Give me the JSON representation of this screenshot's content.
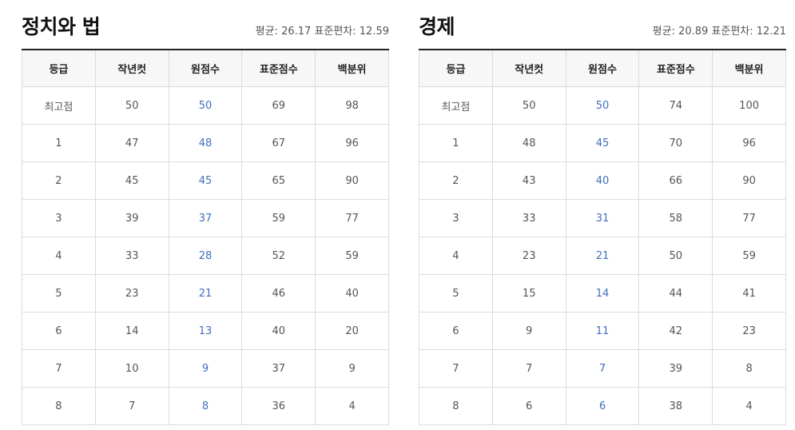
{
  "panels": [
    {
      "title": "정치와 법",
      "stats": "평균: 26.17 표준편차: 12.59",
      "headers": [
        "등급",
        "작년컷",
        "원점수",
        "표준점수",
        "백분위"
      ],
      "rows": [
        [
          "최고점",
          "50",
          "50",
          "69",
          "98"
        ],
        [
          "1",
          "47",
          "48",
          "67",
          "96"
        ],
        [
          "2",
          "45",
          "45",
          "65",
          "90"
        ],
        [
          "3",
          "39",
          "37",
          "59",
          "77"
        ],
        [
          "4",
          "33",
          "28",
          "52",
          "59"
        ],
        [
          "5",
          "23",
          "21",
          "46",
          "40"
        ],
        [
          "6",
          "14",
          "13",
          "40",
          "20"
        ],
        [
          "7",
          "10",
          "9",
          "37",
          "9"
        ],
        [
          "8",
          "7",
          "8",
          "36",
          "4"
        ]
      ]
    },
    {
      "title": "경제",
      "stats": "평균: 20.89 표준편차: 12.21",
      "headers": [
        "등급",
        "작년컷",
        "원점수",
        "표준점수",
        "백분위"
      ],
      "rows": [
        [
          "최고점",
          "50",
          "50",
          "74",
          "100"
        ],
        [
          "1",
          "48",
          "45",
          "70",
          "96"
        ],
        [
          "2",
          "43",
          "40",
          "66",
          "90"
        ],
        [
          "3",
          "33",
          "31",
          "58",
          "77"
        ],
        [
          "4",
          "23",
          "21",
          "50",
          "59"
        ],
        [
          "5",
          "15",
          "14",
          "44",
          "41"
        ],
        [
          "6",
          "9",
          "11",
          "42",
          "23"
        ],
        [
          "7",
          "7",
          "7",
          "39",
          "8"
        ],
        [
          "8",
          "6",
          "6",
          "38",
          "4"
        ]
      ]
    }
  ],
  "colors": {
    "raw_score": "#3f6fbd",
    "header_bg": "#f7f7f7",
    "border": "#dcdcdc"
  }
}
